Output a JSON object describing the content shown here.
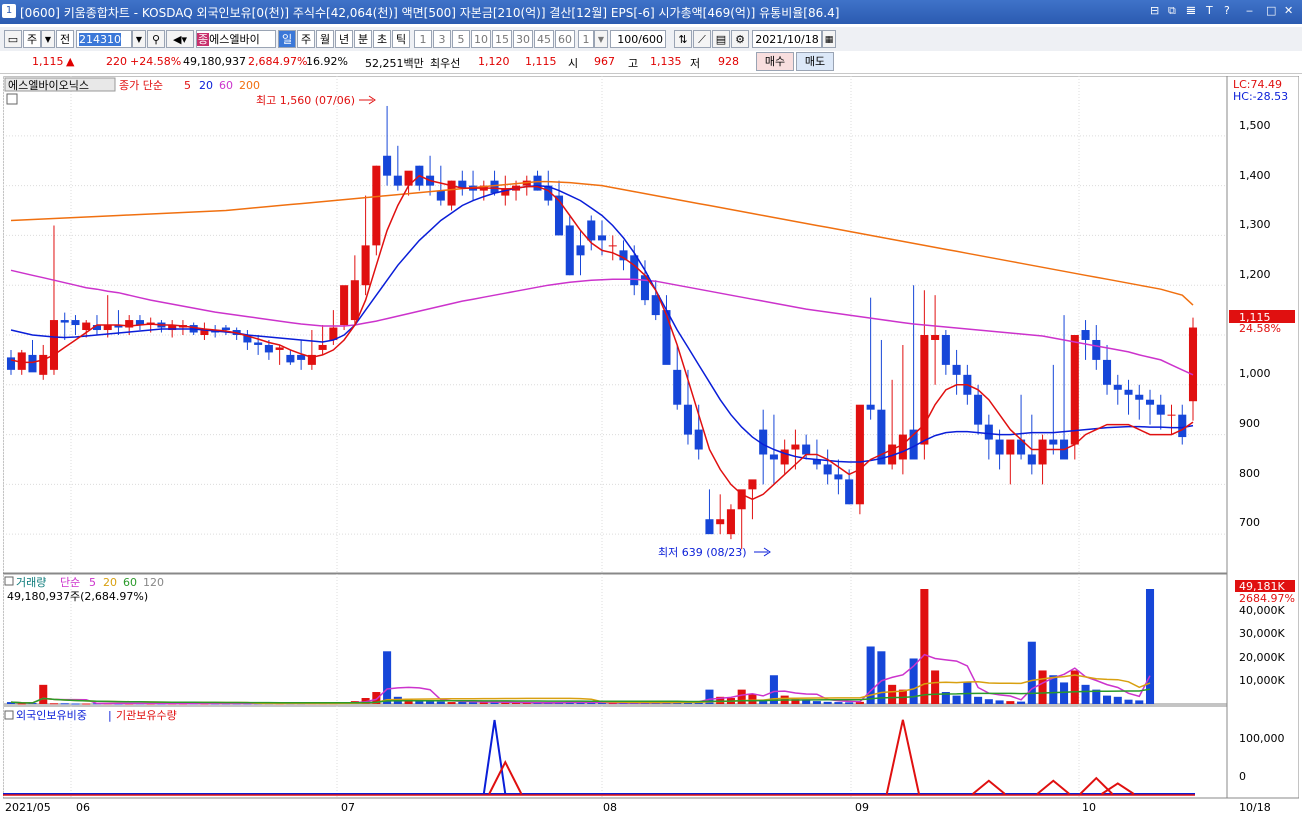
{
  "titlebar": {
    "window_num": "1",
    "title": "[0600] 키움종합차트 - KOSDAQ 외국인보유[0(천)] 주식수[42,064(천)] 액면[500] 자본금[210(억)] 결산[12월] EPS[-6] 시가총액[469(억)] 유통비율[86.4]",
    "controls": [
      "⊟",
      "⧉",
      "𝌆",
      "T",
      "?",
      "‒",
      "□",
      "✕"
    ]
  },
  "toolbar": {
    "period_label": "주",
    "prev_label": "전",
    "code": "214310",
    "stock_name": "에스엘바이",
    "periods": [
      "일",
      "주",
      "월",
      "년",
      "분",
      "초",
      "틱"
    ],
    "minutes": [
      "1",
      "3",
      "5",
      "10",
      "15",
      "30",
      "45",
      "60"
    ],
    "unit": "1",
    "count": "100",
    "count_total": "/600",
    "date": "2021/10/18"
  },
  "quote": {
    "price": "1,115",
    "arrow": "▲",
    "change": "220",
    "change_pct": "+24.58%",
    "volume": "49,180,937",
    "volume_ratio": "2,684.97%",
    "turnover": "16.92%",
    "amount": "52,251백만",
    "best_label": "최우선",
    "best_ask": "1,120",
    "best_bid": "1,115",
    "open_label": "시",
    "open": "967",
    "high_label": "고",
    "high": "1,135",
    "low_label": "저",
    "low": "928",
    "buy_label": "매수",
    "sell_label": "매도"
  },
  "price_panel": {
    "legend_name": "에스엘바이오닉스",
    "legend_close": "종가 단순",
    "ma_labels": [
      "5",
      "20",
      "60",
      "200"
    ],
    "lc": "LC:74.49",
    "hc": "HC:-28.53",
    "high_note": "최고 1,560 (07/06)",
    "low_note": "최저 639 (08/23)",
    "price_tag": "1,115",
    "pct_tag": "24.58%",
    "y_ticks": [
      "1,500",
      "1,400",
      "1,300",
      "1,200",
      "1,100",
      "1,000",
      "900",
      "800",
      "700"
    ]
  },
  "volume_panel": {
    "legend_title": "거래량",
    "legend_ma": "단순",
    "ma_labels": [
      "5",
      "20",
      "60",
      "120"
    ],
    "info": "49,180,937주(2,684.97%)",
    "tag_value": "49,181K",
    "tag_pct": "2684.97%",
    "y_ticks": [
      "40,000K",
      "30,000K",
      "20,000K",
      "10,000K"
    ]
  },
  "foreign_panel": {
    "legend_foreign": "외국인보유비중",
    "legend_inst": "기관보유수량",
    "y_ticks": [
      "100,000",
      "0"
    ]
  },
  "x_axis": {
    "labels": [
      "2021/05",
      "06",
      "07",
      "08",
      "09",
      "10"
    ],
    "end_label": "10/18"
  },
  "colors": {
    "up": "#e01010",
    "down": "#1646d8",
    "ma5": "#e01010",
    "ma20": "#0a1ed8",
    "ma60": "#cc33cc",
    "ma200": "#f07010"
  },
  "chart_data": {
    "type": "candlestick",
    "x": [
      "05/06",
      "05/07",
      "05/10",
      "05/11",
      "05/12",
      "05/13",
      "05/14",
      "05/17",
      "05/18",
      "05/20",
      "05/21",
      "05/24",
      "05/25",
      "05/26",
      "05/27",
      "05/28",
      "05/31",
      "06/01",
      "06/02",
      "06/03",
      "06/04",
      "06/07",
      "06/08",
      "06/09",
      "06/10",
      "06/11",
      "06/14",
      "06/15",
      "06/16",
      "06/17",
      "06/18",
      "06/21",
      "06/22",
      "06/23",
      "06/24",
      "06/25",
      "06/28",
      "06/29",
      "06/30",
      "07/01",
      "07/02",
      "07/05",
      "07/06",
      "07/07",
      "07/08",
      "07/09",
      "07/12",
      "07/13",
      "07/14",
      "07/15",
      "07/16",
      "07/19",
      "07/20",
      "07/21",
      "07/22",
      "07/23",
      "07/26",
      "07/27",
      "07/28",
      "07/29",
      "07/30",
      "08/02",
      "08/03",
      "08/04",
      "08/05",
      "08/06",
      "08/09",
      "08/10",
      "08/11",
      "08/12",
      "08/13",
      "08/17",
      "08/18",
      "08/19",
      "08/20",
      "08/23",
      "08/24",
      "08/25",
      "08/26",
      "08/27",
      "08/30",
      "08/31",
      "09/01",
      "09/02",
      "09/03",
      "09/06",
      "09/07",
      "09/08",
      "09/09",
      "09/10",
      "09/13",
      "09/14",
      "09/15",
      "09/16",
      "09/17",
      "09/23",
      "09/24",
      "09/27",
      "09/28",
      "09/29",
      "09/30",
      "10/01",
      "10/05",
      "10/06",
      "10/07",
      "10/08",
      "10/12",
      "10/13",
      "10/14",
      "10/15",
      "10/18"
    ],
    "open": [
      1055,
      1030,
      1060,
      1020,
      1030,
      1130,
      1130,
      1110,
      1120,
      1110,
      1120,
      1115,
      1130,
      1120,
      1125,
      1110,
      1115,
      1120,
      1100,
      1110,
      1115,
      1110,
      1100,
      1085,
      1080,
      1070,
      1060,
      1060,
      1040,
      1070,
      1090,
      1120,
      1130,
      1200,
      1280,
      1460,
      1420,
      1400,
      1440,
      1420,
      1390,
      1360,
      1410,
      1400,
      1390,
      1410,
      1380,
      1390,
      1400,
      1420,
      1400,
      1380,
      1320,
      1280,
      1330,
      1300,
      1280,
      1270,
      1260,
      1220,
      1180,
      1150,
      1030,
      960,
      910,
      730,
      720,
      700,
      750,
      790,
      910,
      860,
      840,
      870,
      880,
      850,
      840,
      820,
      810,
      760,
      960,
      950,
      840,
      850,
      910,
      880,
      1090,
      1100,
      1040,
      1020,
      980,
      920,
      890,
      860,
      890,
      860,
      840,
      890,
      890,
      880,
      1110,
      1090,
      1050,
      1000,
      990,
      980,
      970,
      960,
      940,
      940,
      967
    ],
    "high": [
      1070,
      1070,
      1090,
      1080,
      1320,
      1145,
      1140,
      1130,
      1140,
      1180,
      1150,
      1140,
      1140,
      1135,
      1130,
      1130,
      1130,
      1125,
      1125,
      1120,
      1120,
      1115,
      1110,
      1100,
      1090,
      1080,
      1070,
      1090,
      1110,
      1120,
      1150,
      1190,
      1260,
      1380,
      1440,
      1560,
      1480,
      1420,
      1440,
      1460,
      1440,
      1410,
      1430,
      1430,
      1410,
      1430,
      1420,
      1410,
      1420,
      1430,
      1430,
      1410,
      1340,
      1310,
      1340,
      1330,
      1300,
      1290,
      1280,
      1250,
      1210,
      1180,
      1080,
      1030,
      960,
      790,
      780,
      760,
      770,
      800,
      950,
      940,
      890,
      910,
      900,
      890,
      870,
      850,
      830,
      880,
      1175,
      1090,
      1010,
      1080,
      1200,
      1190,
      1180,
      1110,
      1070,
      1040,
      1000,
      940,
      910,
      880,
      980,
      940,
      900,
      1040,
      1140,
      1020,
      1130,
      1120,
      1080,
      1020,
      1010,
      1000,
      990,
      980,
      960,
      960,
      1135
    ],
    "low": [
      1020,
      1020,
      1030,
      1010,
      1020,
      1090,
      1100,
      1095,
      1100,
      1095,
      1100,
      1100,
      1110,
      1105,
      1105,
      1095,
      1100,
      1100,
      1090,
      1095,
      1100,
      1090,
      1070,
      1060,
      1050,
      1040,
      1040,
      1030,
      1030,
      1060,
      1080,
      1110,
      1120,
      1180,
      1260,
      1400,
      1390,
      1380,
      1390,
      1380,
      1360,
      1350,
      1380,
      1370,
      1370,
      1380,
      1360,
      1370,
      1380,
      1390,
      1360,
      1320,
      1220,
      1220,
      1270,
      1260,
      1250,
      1230,
      1180,
      1160,
      1130,
      1050,
      950,
      880,
      850,
      720,
      700,
      690,
      670,
      730,
      800,
      800,
      820,
      830,
      850,
      830,
      800,
      780,
      760,
      740,
      930,
      910,
      830,
      820,
      870,
      850,
      1000,
      1020,
      980,
      960,
      900,
      850,
      830,
      800,
      850,
      820,
      800,
      860,
      860,
      850,
      1050,
      1030,
      980,
      960,
      940,
      930,
      920,
      910,
      900,
      880,
      928
    ],
    "close": [
      1030,
      1065,
      1025,
      1060,
      1130,
      1125,
      1120,
      1125,
      1110,
      1120,
      1115,
      1130,
      1120,
      1125,
      1115,
      1120,
      1120,
      1105,
      1110,
      1105,
      1110,
      1100,
      1085,
      1080,
      1065,
      1075,
      1045,
      1050,
      1060,
      1080,
      1115,
      1200,
      1210,
      1280,
      1440,
      1420,
      1400,
      1430,
      1400,
      1400,
      1370,
      1410,
      1395,
      1390,
      1400,
      1385,
      1395,
      1400,
      1410,
      1390,
      1370,
      1300,
      1220,
      1260,
      1290,
      1290,
      1280,
      1250,
      1200,
      1170,
      1140,
      1040,
      960,
      900,
      870,
      700,
      730,
      750,
      790,
      810,
      860,
      850,
      870,
      880,
      860,
      840,
      820,
      810,
      760,
      960,
      950,
      840,
      880,
      900,
      850,
      1100,
      1100,
      1040,
      1020,
      980,
      920,
      890,
      860,
      890,
      860,
      840,
      890,
      880,
      850,
      1100,
      1090,
      1050,
      1000,
      990,
      980,
      970,
      960,
      940,
      940,
      895,
      1115
    ],
    "ma5": [
      1050,
      1045,
      1045,
      1050,
      1060,
      1075,
      1090,
      1105,
      1120,
      1120,
      1120,
      1118,
      1120,
      1122,
      1120,
      1120,
      1118,
      1115,
      1112,
      1110,
      1108,
      1104,
      1098,
      1092,
      1085,
      1080,
      1070,
      1062,
      1055,
      1060,
      1070,
      1090,
      1120,
      1170,
      1240,
      1310,
      1360,
      1400,
      1420,
      1410,
      1405,
      1400,
      1395,
      1395,
      1395,
      1395,
      1393,
      1395,
      1398,
      1398,
      1390,
      1370,
      1340,
      1310,
      1285,
      1270,
      1265,
      1255,
      1240,
      1220,
      1190,
      1140,
      1080,
      1010,
      940,
      870,
      830,
      800,
      780,
      770,
      780,
      800,
      820,
      840,
      860,
      860,
      850,
      835,
      820,
      830,
      850,
      860,
      870,
      880,
      900,
      920,
      960,
      990,
      1000,
      1000,
      990,
      970,
      940,
      910,
      890,
      870,
      870,
      870,
      870,
      880,
      900,
      910,
      920,
      920,
      920,
      910,
      900,
      900,
      900,
      910,
      925
    ],
    "ma20": [
      1110,
      1105,
      1100,
      1098,
      1096,
      1095,
      1096,
      1098,
      1100,
      1102,
      1104,
      1106,
      1108,
      1110,
      1112,
      1112,
      1112,
      1112,
      1110,
      1108,
      1106,
      1104,
      1100,
      1098,
      1096,
      1094,
      1092,
      1090,
      1088,
      1086,
      1090,
      1100,
      1120,
      1150,
      1180,
      1210,
      1240,
      1265,
      1290,
      1310,
      1330,
      1345,
      1360,
      1370,
      1378,
      1385,
      1390,
      1395,
      1398,
      1400,
      1398,
      1390,
      1380,
      1370,
      1355,
      1340,
      1320,
      1295,
      1265,
      1230,
      1190,
      1150,
      1110,
      1075,
      1040,
      1005,
      970,
      940,
      915,
      895,
      880,
      870,
      862,
      856,
      852,
      850,
      848,
      846,
      845,
      845,
      848,
      852,
      858,
      866,
      876,
      888,
      898,
      904,
      906,
      906,
      904,
      902,
      900,
      900,
      902,
      904,
      904,
      904,
      906,
      908,
      910,
      912,
      914,
      915,
      916,
      916,
      915,
      915,
      914,
      914,
      918
    ],
    "ma60": [
      1230,
      1225,
      1220,
      1215,
      1210,
      1205,
      1200,
      1195,
      1192,
      1188,
      1185,
      1180,
      1175,
      1170,
      1166,
      1162,
      1158,
      1154,
      1150,
      1146,
      1143,
      1140,
      1137,
      1134,
      1131,
      1128,
      1125,
      1122,
      1120,
      1118,
      1118,
      1118,
      1120,
      1124,
      1128,
      1133,
      1138,
      1143,
      1148,
      1153,
      1158,
      1163,
      1168,
      1172,
      1176,
      1180,
      1184,
      1188,
      1192,
      1196,
      1200,
      1203,
      1206,
      1208,
      1210,
      1211,
      1212,
      1212,
      1212,
      1210,
      1208,
      1204,
      1200,
      1196,
      1192,
      1188,
      1184,
      1180,
      1176,
      1172,
      1168,
      1164,
      1160,
      1156,
      1152,
      1149,
      1146,
      1143,
      1140,
      1137,
      1134,
      1131,
      1128,
      1125,
      1122,
      1120,
      1118,
      1116,
      1114,
      1112,
      1110,
      1108,
      1106,
      1104,
      1102,
      1100,
      1098,
      1094,
      1090,
      1086,
      1082,
      1078,
      1074,
      1070,
      1066,
      1060,
      1055,
      1050,
      1040,
      1030,
      1020
    ],
    "ma200": [
      1330,
      1331,
      1332,
      1333,
      1334,
      1335,
      1336,
      1337,
      1338,
      1339,
      1340,
      1341,
      1342,
      1343,
      1344,
      1345,
      1346,
      1347,
      1348,
      1349,
      1350,
      1352,
      1354,
      1356,
      1358,
      1360,
      1362,
      1364,
      1366,
      1368,
      1370,
      1372,
      1374,
      1376,
      1378,
      1380,
      1382,
      1384,
      1386,
      1388,
      1390,
      1392,
      1394,
      1396,
      1398,
      1400,
      1402,
      1404,
      1406,
      1408,
      1408,
      1407,
      1406,
      1404,
      1402,
      1400,
      1396,
      1392,
      1388,
      1384,
      1380,
      1376,
      1372,
      1368,
      1364,
      1360,
      1356,
      1352,
      1348,
      1344,
      1340,
      1336,
      1332,
      1328,
      1324,
      1320,
      1316,
      1312,
      1308,
      1304,
      1300,
      1296,
      1292,
      1288,
      1284,
      1280,
      1276,
      1272,
      1268,
      1264,
      1260,
      1256,
      1252,
      1248,
      1244,
      1240,
      1236,
      1232,
      1228,
      1224,
      1220,
      1216,
      1212,
      1208,
      1204,
      1200,
      1196,
      1192,
      1186,
      1180,
      1160
    ],
    "volume": [
      800,
      200,
      400,
      8000,
      300,
      300,
      200,
      200,
      300,
      300,
      200,
      200,
      300,
      200,
      200,
      200,
      200,
      300,
      200,
      200,
      200,
      200,
      200,
      200,
      200,
      200,
      200,
      200,
      300,
      300,
      300,
      600,
      1200,
      2500,
      5000,
      22000,
      3000,
      2200,
      1500,
      1200,
      1000,
      800,
      900,
      800,
      700,
      700,
      600,
      600,
      500,
      600,
      500,
      800,
      900,
      600,
      500,
      500,
      400,
      500,
      500,
      600,
      600,
      800,
      900,
      1200,
      1000,
      6000,
      3000,
      2500,
      6000,
      4000,
      1500,
      12000,
      3500,
      2000,
      1800,
      1200,
      900,
      800,
      700,
      900,
      24000,
      22000,
      8000,
      6000,
      19000,
      48000,
      14000,
      5000,
      3500,
      9000,
      3000,
      2000,
      1500,
      1200,
      1000,
      26000,
      14000,
      12000,
      9000,
      14000,
      8000,
      6000,
      3500,
      3000,
      1800,
      1500,
      49181
    ],
    "yrange": [
      620,
      1580
    ],
    "volume_range": [
      0,
      48000
    ],
    "foreign_spike_index": 45,
    "inst_spikes": [
      {
        "i": 46,
        "v": 60
      },
      {
        "i": 83,
        "v": 140
      },
      {
        "i": 91,
        "v": 25
      },
      {
        "i": 97,
        "v": 25
      },
      {
        "i": 101,
        "v": 30
      },
      {
        "i": 103,
        "v": 20
      }
    ]
  }
}
